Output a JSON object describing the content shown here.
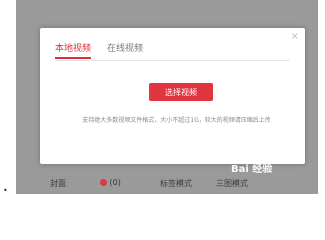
{
  "modal": {
    "tabs": [
      {
        "label": "本地视频",
        "active": true
      },
      {
        "label": "在线视频",
        "active": false
      }
    ],
    "close_glyph": "×",
    "select_button_label": "选择视频",
    "hint": "支持绝大多数视频文件格式，大小不超过1G，较大的视频请压缩后上传"
  },
  "backdrop": {
    "cover_label": "封面",
    "option_1": "(0)",
    "option_2": "标签模式",
    "option_3": "三图模式"
  },
  "watermark": "Bai 经验",
  "bullet": "•",
  "colors": {
    "accent": "#e0363f",
    "overlay": "#9a9a9a"
  }
}
